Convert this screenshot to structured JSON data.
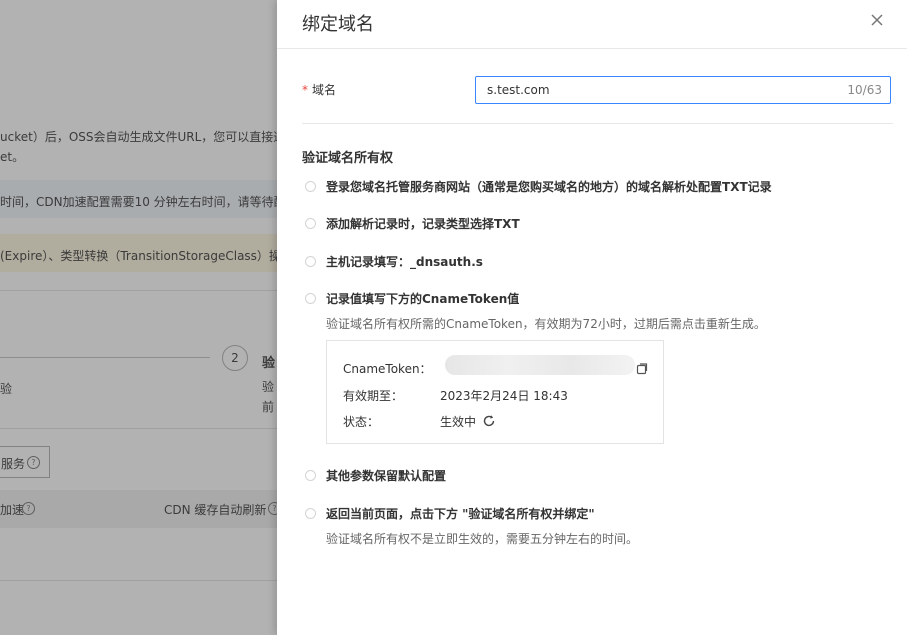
{
  "background": {
    "line1": "ucket）后，OSS会自动生成文件URL，您可以直接通",
    "line2": "et。",
    "line3": "时间，CDN加速配置需要10 分钟左右时间，请等待配",
    "line4": "(Expire）、类型转换（TransitionStorageClass）操作",
    "step_number": "2",
    "step_title": "验",
    "step_left_fragment": "验",
    "step_desc_fragment": "验",
    "step_desc_fragment2": "前",
    "service_button": "服务",
    "accel_label": "加速",
    "cdn_refresh_label": "CDN 缓存自动刷新",
    "left_fragment": "验"
  },
  "drawer": {
    "title": "绑定域名",
    "form": {
      "required_mark": "*",
      "domain_label": "域名",
      "domain_value": "s.test.com",
      "char_count": "10/63"
    },
    "section_title": "验证域名所有权",
    "steps": [
      {
        "text": "登录您域名托管服务商网站（通常是您购买域名的地方）的域名解析处配置TXT记录"
      },
      {
        "text": "添加解析记录时，记录类型选择TXT"
      },
      {
        "text": "主机记录填写：_dnsauth.s"
      },
      {
        "text": "记录值填写下方的CnameToken值",
        "desc": "验证域名所有权所需的CnameToken，有效期为72小时，过期后需点击重新生成。"
      },
      {
        "text": "其他参数保留默认配置"
      },
      {
        "text": "返回当前页面，点击下方 \"验证域名所有权并绑定\"",
        "desc": "验证域名所有权不是立即生效的，需要五分钟左右的时间。"
      }
    ],
    "token": {
      "token_label": "CnameToken：",
      "expiry_label": "有效期至：",
      "expiry_value": "2023年2月24日 18:43",
      "status_label": "状态：",
      "status_value": "生效中"
    }
  },
  "icons": {
    "close": "close-icon",
    "copy": "copy-icon",
    "refresh": "refresh-icon",
    "help": "question-circle-icon"
  }
}
